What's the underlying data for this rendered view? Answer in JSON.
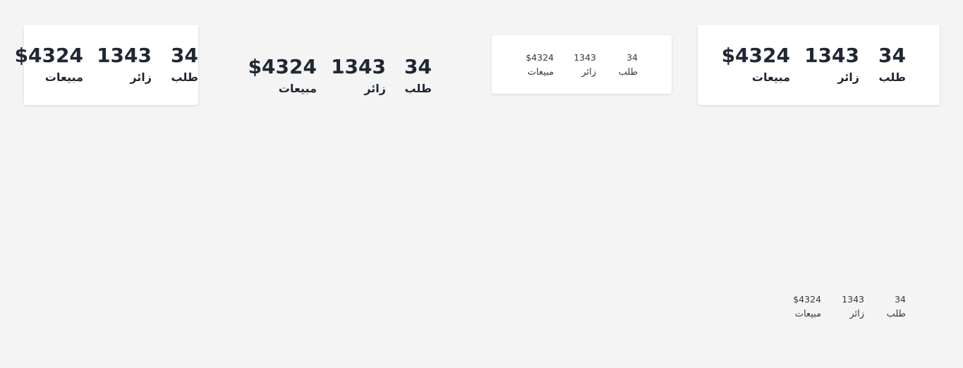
{
  "widgets": [
    {
      "stats": [
        {
          "value": "34",
          "label": "طلب"
        },
        {
          "value": "1343",
          "label": "زائر"
        },
        {
          "value": "$4324",
          "label": "مبيعات"
        }
      ]
    },
    {
      "stats": [
        {
          "value": "34",
          "label": "طلب"
        },
        {
          "value": "1343",
          "label": "زائر"
        },
        {
          "value": "$4324",
          "label": "مبيعات"
        }
      ]
    },
    {
      "stats": [
        {
          "value": "34",
          "label": "طلب"
        },
        {
          "value": "1343",
          "label": "زائر"
        },
        {
          "value": "$4324",
          "label": "مبيعات"
        }
      ]
    },
    {
      "stats": [
        {
          "value": "34",
          "label": "طلب"
        },
        {
          "value": "1343",
          "label": "زائر"
        },
        {
          "value": "$4324",
          "label": "مبيعات"
        }
      ]
    },
    {
      "stats": [
        {
          "value": "34",
          "label": "طلب"
        },
        {
          "value": "1343",
          "label": "زائر"
        },
        {
          "value": "$4324",
          "label": "مبيعات"
        }
      ]
    }
  ]
}
